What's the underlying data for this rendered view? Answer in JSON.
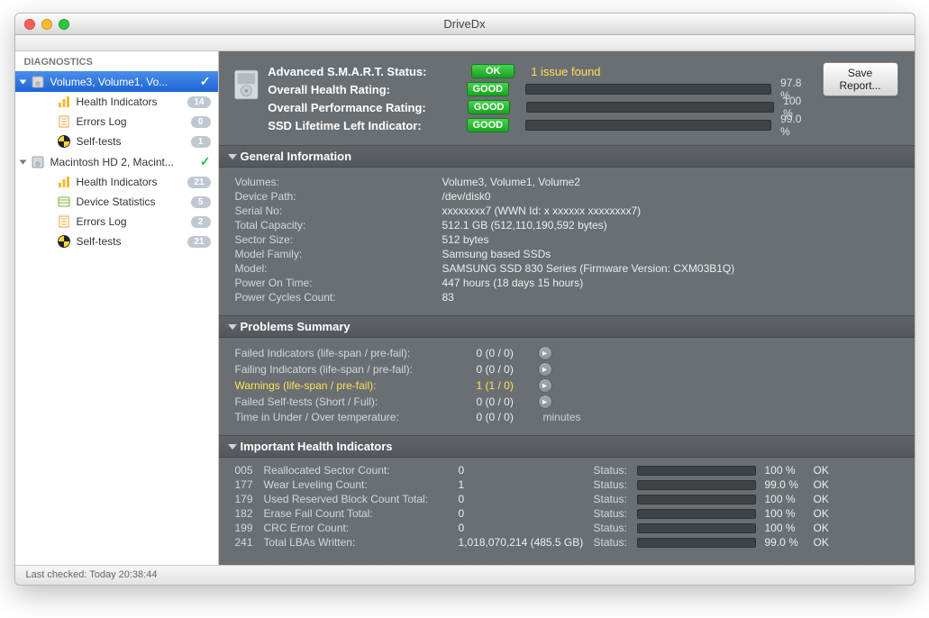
{
  "app_title": "DriveDx",
  "sidebar": {
    "header": "DIAGNOSTICS",
    "drives": [
      {
        "label": "Volume3, Volume1, Vo...",
        "selected": true,
        "children": [
          {
            "icon": "health",
            "label": "Health Indicators",
            "badge": "14"
          },
          {
            "icon": "log",
            "label": "Errors Log",
            "badge": "0"
          },
          {
            "icon": "self",
            "label": "Self-tests",
            "badge": "1"
          }
        ]
      },
      {
        "label": "Macintosh HD 2, Macint...",
        "selected": false,
        "children": [
          {
            "icon": "health",
            "label": "Health Indicators",
            "badge": "21"
          },
          {
            "icon": "stats",
            "label": "Device Statistics",
            "badge": "5"
          },
          {
            "icon": "log",
            "label": "Errors Log",
            "badge": "2"
          },
          {
            "icon": "self",
            "label": "Self-tests",
            "badge": "21"
          }
        ]
      }
    ]
  },
  "smart": {
    "rows": [
      {
        "label": "Advanced S.M.A.R.T. Status:",
        "pill": "OK",
        "issue": "1 issue found"
      },
      {
        "label": "Overall Health Rating:",
        "pill": "GOOD",
        "pct": "97.8 %",
        "fill": 97.8
      },
      {
        "label": "Overall Performance Rating:",
        "pill": "GOOD",
        "pct": "100 %",
        "fill": 100
      },
      {
        "label": "SSD Lifetime Left Indicator:",
        "pill": "GOOD",
        "pct": "99.0 %",
        "fill": 99.0
      }
    ],
    "save_label": "Save Report..."
  },
  "sections": {
    "general_title": "General Information",
    "problems_title": "Problems Summary",
    "indicators_title": "Important Health Indicators"
  },
  "general": [
    {
      "k": "Volumes:",
      "v": "Volume3, Volume1, Volume2"
    },
    {
      "k": "Device Path:",
      "v": "/dev/disk0"
    },
    {
      "k": "Serial No:",
      "v": "xxxxxxxx7 (WWN Id: x xxxxxx xxxxxxxx7)"
    },
    {
      "k": "Total Capacity:",
      "v": "512.1 GB (512,110,190,592 bytes)"
    },
    {
      "k": "Sector Size:",
      "v": "512 bytes"
    },
    {
      "k": "Model Family:",
      "v": "Samsung based SSDs"
    },
    {
      "k": "Model:",
      "v": "SAMSUNG SSD 830 Series  (Firmware Version: CXM03B1Q)"
    },
    {
      "k": "Power On Time:",
      "v": "447 hours (18 days 15 hours)"
    },
    {
      "k": "Power Cycles Count:",
      "v": "83"
    }
  ],
  "problems": [
    {
      "k": "Failed Indicators (life-span / pre-fail):",
      "v": "0 (0 / 0)",
      "btn": true
    },
    {
      "k": "Failing Indicators (life-span / pre-fail):",
      "v": "0 (0 / 0)",
      "btn": true
    },
    {
      "k": "Warnings (life-span / pre-fail):",
      "v": "1 (1 / 0)",
      "btn": true,
      "warn": true
    },
    {
      "k": "Failed Self-tests (Short / Full):",
      "v": "0 (0 / 0)",
      "btn": true
    },
    {
      "k": "Time in Under / Over temperature:",
      "v": "0 (0 / 0)",
      "extra": "minutes"
    }
  ],
  "indicators": [
    {
      "id": "005",
      "name": "Reallocated Sector Count:",
      "val": "0",
      "pct": "100 %",
      "fill": 100,
      "ok": "OK"
    },
    {
      "id": "177",
      "name": "Wear Leveling Count:",
      "val": "1",
      "pct": "99.0 %",
      "fill": 99.0,
      "ok": "OK"
    },
    {
      "id": "179",
      "name": "Used Reserved Block Count Total:",
      "val": "0",
      "pct": "100 %",
      "fill": 100,
      "ok": "OK"
    },
    {
      "id": "182",
      "name": "Erase Fail Count Total:",
      "val": "0",
      "pct": "100 %",
      "fill": 100,
      "ok": "OK"
    },
    {
      "id": "199",
      "name": "CRC Error Count:",
      "val": "0",
      "pct": "100 %",
      "fill": 100,
      "ok": "OK"
    },
    {
      "id": "241",
      "name": "Total LBAs Written:",
      "val": "1,018,070,214 (485.5 GB)",
      "pct": "99.0 %",
      "fill": 99.0,
      "ok": "OK"
    }
  ],
  "status_text": "Last checked: Today 20:38:44",
  "labels": {
    "status": "Status:"
  }
}
